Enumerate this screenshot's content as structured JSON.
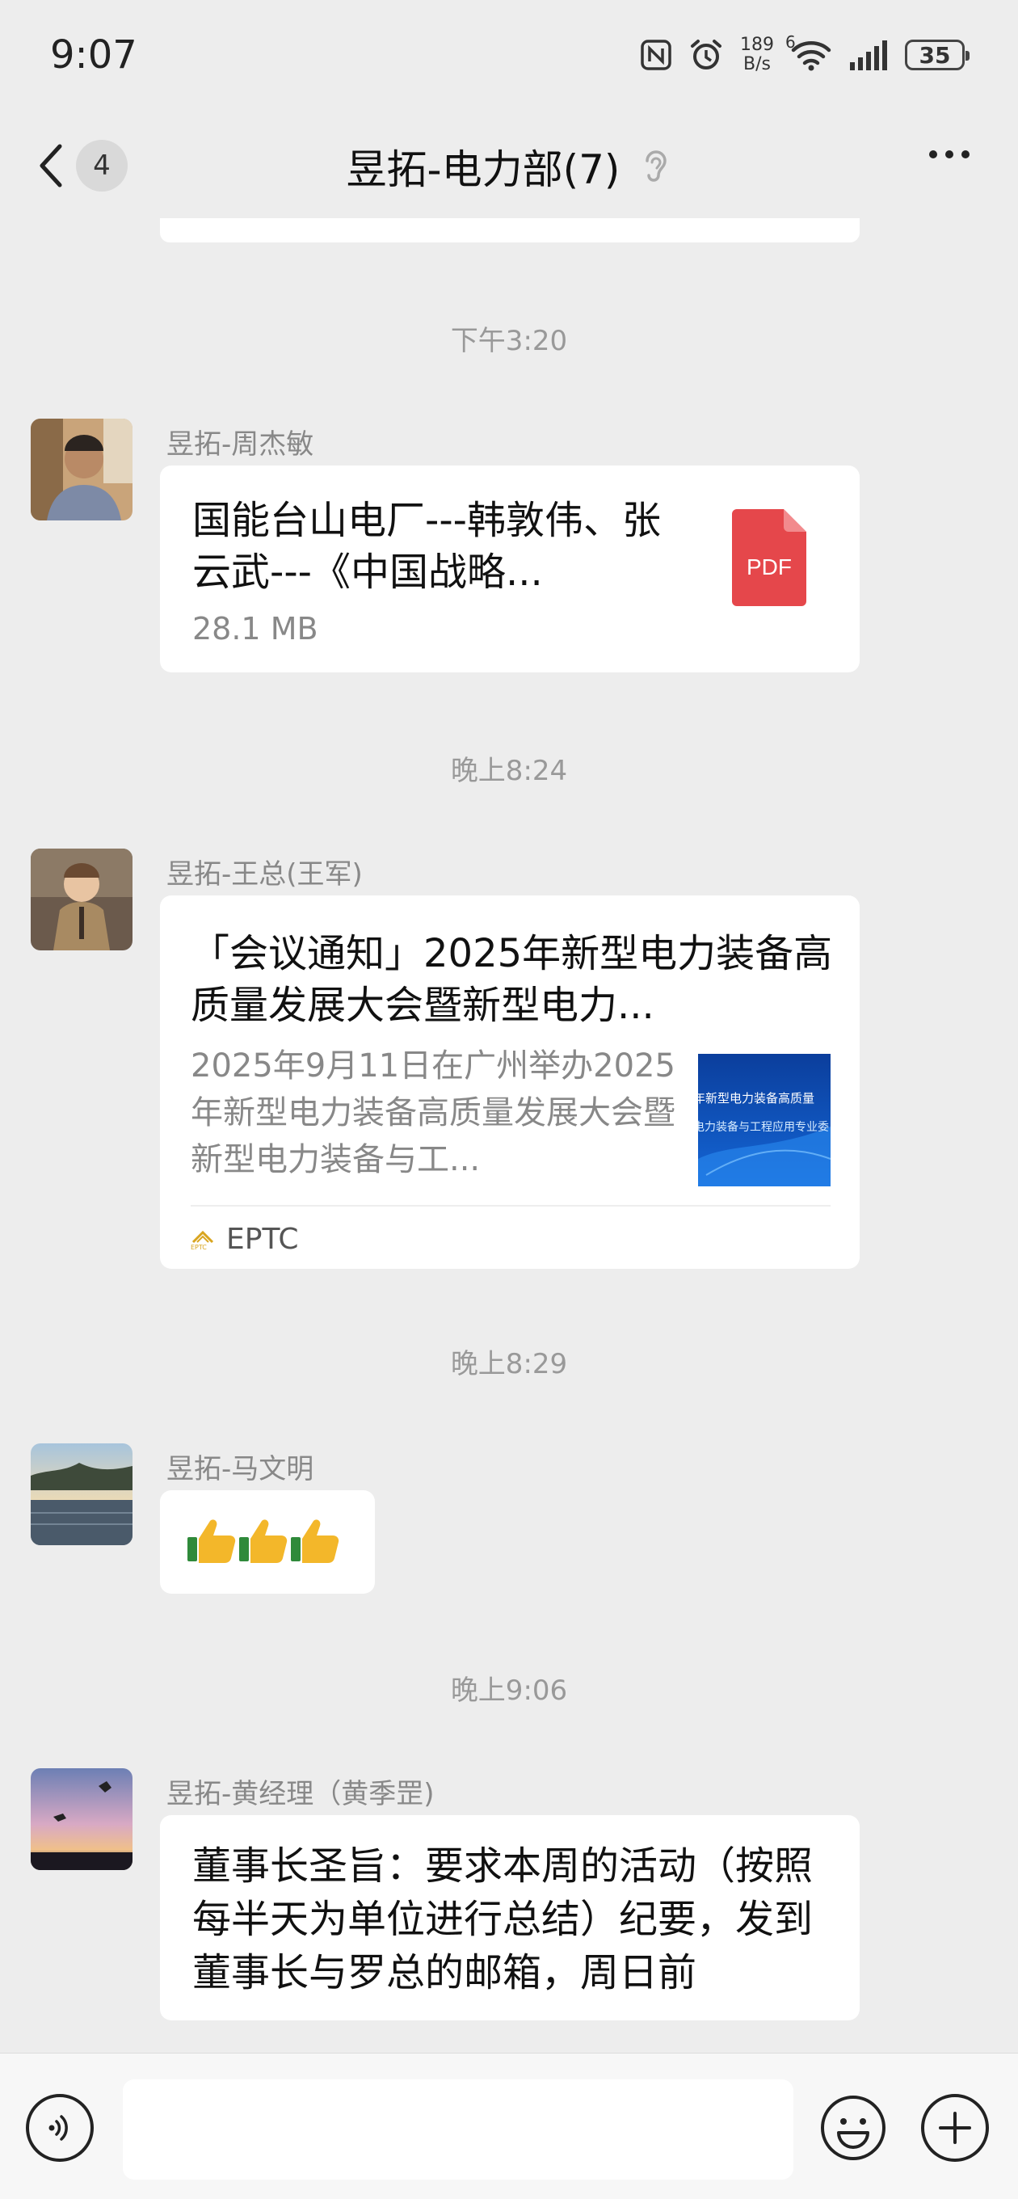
{
  "status_bar": {
    "time": "9:07",
    "net_speed_value": "189",
    "net_speed_unit": "B/s",
    "signal_label": "6",
    "battery_level": "35",
    "icons": [
      "nfc-icon",
      "alarm-icon",
      "wifi-icon",
      "cellular-signal-icon",
      "battery-icon"
    ]
  },
  "nav": {
    "unread_count": "4",
    "title": "昱拓-电力部(7)",
    "icons": [
      "back-chevron-icon",
      "ear-icon",
      "more-icon"
    ]
  },
  "messages": [
    {
      "time": "下午3:20",
      "sender": "昱拓-周杰敏",
      "type": "file",
      "file_name": "国能台山电厂---韩敦伟、张云武---《中国战略...",
      "file_size": "28.1 MB",
      "file_type_label": "PDF",
      "file_icon_color": "#e5474b"
    },
    {
      "time": "晚上8:24",
      "sender": "昱拓-王总(王军)",
      "type": "link",
      "title": "「会议通知」2025年新型电力装备高质量发展大会暨新型电力...",
      "description": "2025年9月11日在广州举办2025年新型电力装备高质量发展大会暨新型电力装备与工...",
      "thumbnail_lines": [
        "年新型电力装备高质量",
        "电力装备与工程应用专业委"
      ],
      "source_name": "EPTC",
      "source_logo_text": "EPTC"
    },
    {
      "time": "晚上8:29",
      "sender": "昱拓-马文明",
      "type": "emoji",
      "emojis": [
        "👍",
        "👍",
        "👍"
      ]
    },
    {
      "time": "晚上9:06",
      "sender": "昱拓-黄经理（黄季罡)",
      "type": "text",
      "text": "董事长圣旨：要求本周的活动（按照每半天为单位进行总结）纪要，发到董事长与罗总的邮箱，周日前"
    }
  ],
  "input_bar": {
    "input_value": "",
    "icons": [
      "voice-icon",
      "emoji-face-icon",
      "plus-icon"
    ]
  },
  "colors": {
    "background": "#ededed",
    "bubble": "#ffffff",
    "timestamp_text": "#999999",
    "pdf_red": "#e5474b"
  }
}
